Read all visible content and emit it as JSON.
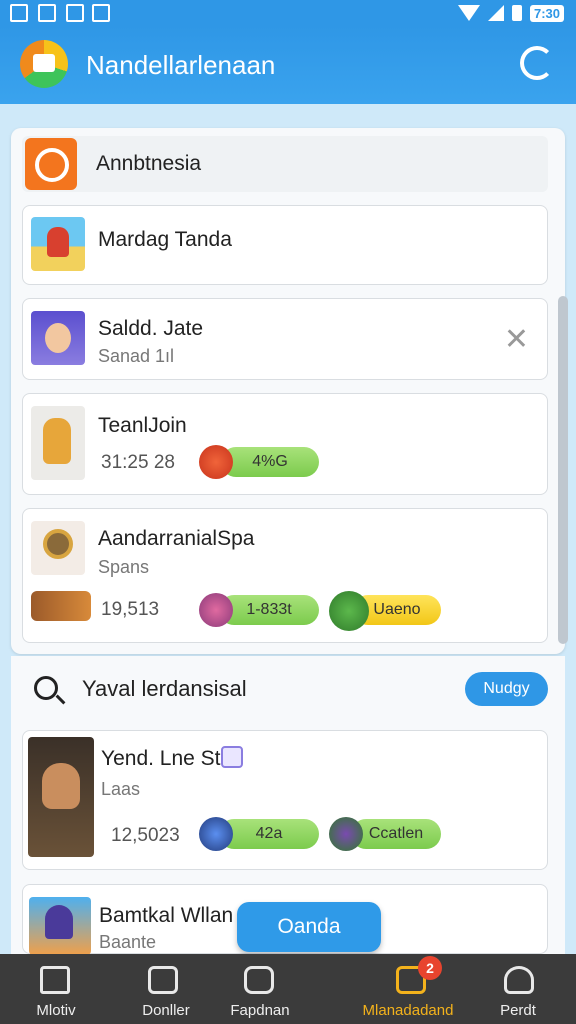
{
  "status_bar": {
    "time": "7:30"
  },
  "app_bar": {
    "title": "Nandellarlenaan"
  },
  "header": {
    "label": "Annbtnesia"
  },
  "list": [
    {
      "title": "Mardag Tanda"
    },
    {
      "title": "Saldd. Jate",
      "subtitle": "Sanad 1ıl"
    },
    {
      "title": "TeanlJoin",
      "number": "31:25 28",
      "pill": "4%G"
    },
    {
      "title": "AandarranialSpa",
      "subtitle": "Spans",
      "number": "19,513",
      "pill_green": "1-833t",
      "pill_yellow": "Uaeno"
    }
  ],
  "search": {
    "label": "Yaval lerdansisal",
    "button": "Nudgy"
  },
  "results": [
    {
      "title": "Yend. Lne St",
      "subtitle": "Laas",
      "number": "12,5023",
      "pill_green": "42a",
      "pill_green_2": "Ccatlen"
    },
    {
      "title": "Bamtkal Wllan",
      "subtitle": "Baante"
    }
  ],
  "fab": {
    "label": "Oanda"
  },
  "bottom_nav": {
    "items": [
      {
        "label": "Mlotiv"
      },
      {
        "label": "Donller"
      },
      {
        "label": "Fapdnan"
      },
      {
        "label": "Mlanadadand"
      },
      {
        "label": "Perdt"
      }
    ],
    "badge": "2"
  },
  "colors": {
    "primary": "#2f97e6",
    "accent": "#f3b21c",
    "pill_green": "#7ccb4d",
    "pill_yellow": "#f2c717"
  }
}
